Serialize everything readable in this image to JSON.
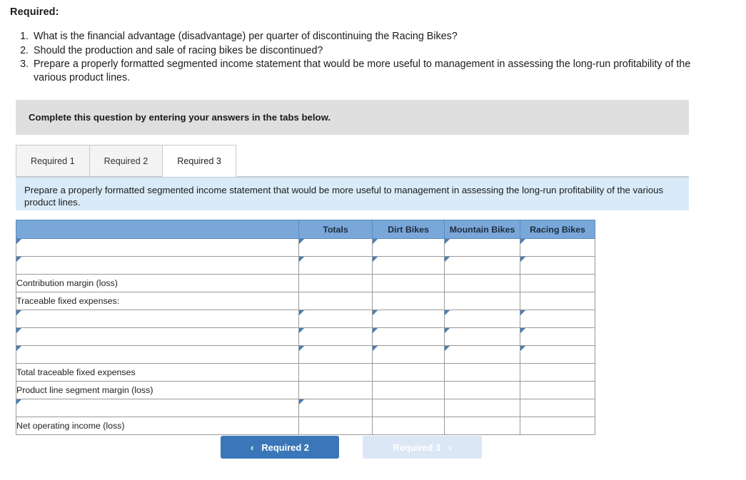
{
  "required": {
    "heading": "Required:",
    "items": [
      "What is the financial advantage (disadvantage) per quarter of discontinuing the Racing Bikes?",
      "Should the production and sale of racing bikes be discontinued?",
      "Prepare a properly formatted segmented income statement that would be more useful to management in assessing the long-run profitability of the various product lines."
    ]
  },
  "complete_bar": {
    "text": "Complete this question by entering your answers in the tabs below."
  },
  "tabs": [
    {
      "label": "Required 1",
      "active": false
    },
    {
      "label": "Required 2",
      "active": false
    },
    {
      "label": "Required 3",
      "active": true
    }
  ],
  "instruction": {
    "text": "Prepare a properly formatted segmented income statement that would be more useful to management in assessing the long-run profitability of the various product lines."
  },
  "table": {
    "headers": [
      "",
      "Totals",
      "Dirt Bikes",
      "Mountain Bikes",
      "Racing Bikes"
    ],
    "rows": [
      {
        "label": "",
        "type": "input",
        "cells": "input"
      },
      {
        "label": "",
        "type": "input",
        "cells": "input"
      },
      {
        "label": "Contribution margin (loss)",
        "type": "static",
        "cells": "blank"
      },
      {
        "label": "Traceable fixed expenses:",
        "type": "static",
        "cells": "blank"
      },
      {
        "label": "",
        "type": "input",
        "cells": "input"
      },
      {
        "label": "",
        "type": "input",
        "cells": "input"
      },
      {
        "label": "",
        "type": "input",
        "cells": "input"
      },
      {
        "label": "Total traceable fixed expenses",
        "type": "static",
        "cells": "blank"
      },
      {
        "label": "Product line segment margin (loss)",
        "type": "static",
        "cells": "blank"
      },
      {
        "label": "",
        "type": "input",
        "cells": "totals-only-input"
      },
      {
        "label": "Net operating income (loss)",
        "type": "static",
        "cells": "totals-only-blank"
      }
    ]
  },
  "nav": {
    "prev_label": "Required 2",
    "next_label": "Required 3",
    "prev_chevron": "‹",
    "next_chevron": "›"
  },
  "colors": {
    "header_blue": "#7aa7d9",
    "panel_blue": "#d9ebf8",
    "gray_bar": "#dfdfdf",
    "button_blue": "#3b77b8",
    "button_disabled": "#dce7f5",
    "input_border": "#6a9ac9",
    "corner_marker": "#4a7fb5"
  }
}
